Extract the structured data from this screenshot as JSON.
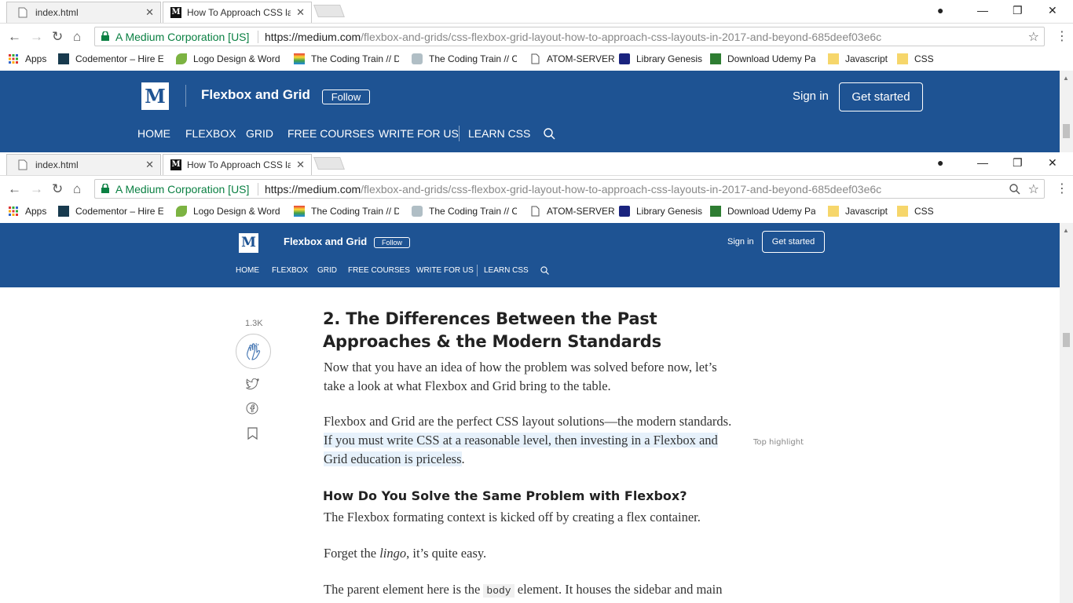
{
  "browser": {
    "tabs": [
      {
        "title": "index.html",
        "active": false
      },
      {
        "title": "How To Approach CSS la",
        "active": true
      }
    ],
    "site_identity": "A Medium Corporation [US]",
    "url_host": "https://medium.com",
    "url_path": "/flexbox-and-grids/css-flexbox-grid-layout-how-to-approach-css-layouts-in-2017-and-beyond-685deef03e6c",
    "bookmarks": [
      {
        "label": "Apps",
        "icon": "apps-grid-icon"
      },
      {
        "label": "Codementor – Hire E",
        "icon": "codementor-icon"
      },
      {
        "label": "Logo Design & Word",
        "icon": "leaf-icon"
      },
      {
        "label": "The Coding Train // D",
        "icon": "rainbow-icon"
      },
      {
        "label": "The Coding Train // C",
        "icon": "train-icon"
      },
      {
        "label": "ATOM-SERVER",
        "icon": "page-icon"
      },
      {
        "label": "Library Genesis",
        "icon": "libgen-icon"
      },
      {
        "label": "Download Udemy Pa",
        "icon": "ftu-icon"
      },
      {
        "label": "Javascript",
        "icon": "folder-icon"
      },
      {
        "label": "CSS",
        "icon": "folder-icon"
      }
    ]
  },
  "medium": {
    "logo_letter": "M",
    "publication": "Flexbox and Grid",
    "follow": "Follow",
    "signin": "Sign in",
    "get_started": "Get started",
    "nav": [
      "HOME",
      "FLEXBOX",
      "GRID",
      "FREE COURSES",
      "WRITE FOR US",
      "LEARN CSS"
    ]
  },
  "article": {
    "clap_count": "1.3K",
    "heading": "2. The Differences Between the Past Approaches & the Modern Standards",
    "p1": "Now that you have an idea of how the problem was solved before now, let’s take a look at what Flexbox and Grid bring to the table.",
    "p2_plain": "Flexbox and Grid are the perfect CSS layout solutions—the modern standards. ",
    "p2_highlight": "If you must write CSS at a reasonable level, then investing in a Flexbox and Grid education is priceless",
    "p2_end": ".",
    "top_highlight": "Top highlight",
    "subheading": "How Do You Solve the Same Problem with Flexbox?",
    "p3": "The Flexbox formating context is kicked off by creating a flex container.",
    "p4_start": "Forget the ",
    "p4_em": "lingo",
    "p4_end": ", it’s quite easy.",
    "p5_start": "The parent element here is the ",
    "p5_code": "body",
    "p5_end": " element. It houses the sidebar and main"
  },
  "colors": {
    "medium_blue": "#1e5393",
    "highlight": "#e6f1fb",
    "secure_green": "#0b8043"
  }
}
